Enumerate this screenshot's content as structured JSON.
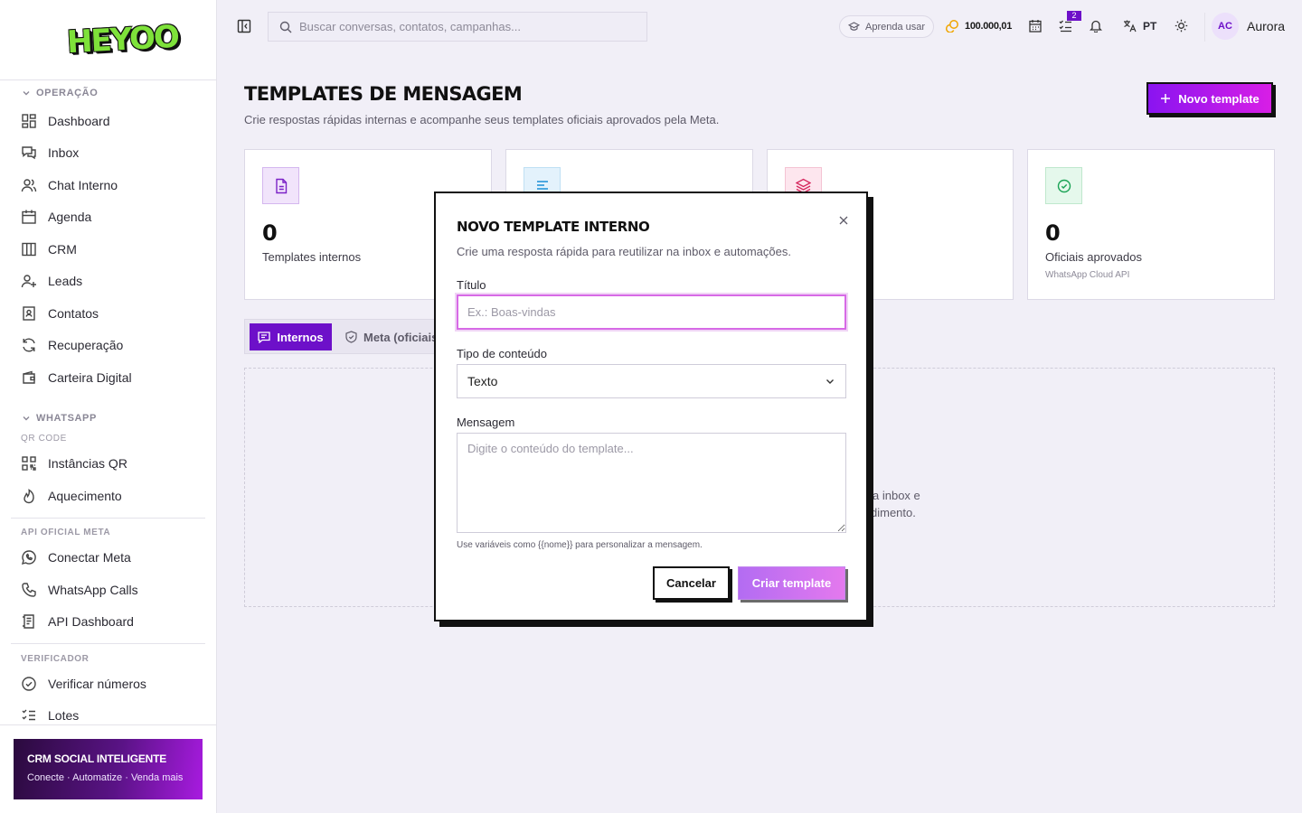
{
  "brand": {
    "logo": "HEYOO"
  },
  "sidebar": {
    "sections": [
      {
        "title": "OPERAÇÃO",
        "items": [
          "Dashboard",
          "Inbox",
          "Chat Interno",
          "Agenda",
          "CRM",
          "Leads",
          "Contatos",
          "Recuperação",
          "Carteira Digital"
        ]
      },
      {
        "title": "WHATSAPP",
        "subtitle": "QR CODE",
        "items": [
          "Instâncias QR",
          "Aquecimento"
        ]
      },
      {
        "title": "API OFICIAL META",
        "items": [
          "Conectar Meta",
          "WhatsApp Calls",
          "API Dashboard"
        ]
      },
      {
        "title": "VERIFICADOR",
        "items": [
          "Verificar números",
          "Lotes"
        ]
      }
    ],
    "promo": {
      "title": "CRM SOCIAL INTELIGENTE",
      "subtitle": "Conecte · Automatize · Venda mais"
    }
  },
  "topbar": {
    "search_placeholder": "Buscar conversas, contatos, campanhas...",
    "learn": "Aprenda usar",
    "coins": "100.000,01",
    "tasks_badge": "2",
    "lang": "PT",
    "user_initials": "AC",
    "user_name": "Aurora"
  },
  "page": {
    "title": "TEMPLATES DE MENSAGEM",
    "subtitle": "Crie respostas rápidas internas e acompanhe seus templates oficiais aprovados pela Meta.",
    "new_button": "Novo template"
  },
  "cards": [
    {
      "value": "0",
      "label": "Templates internos",
      "icon": "file-text-icon"
    },
    {
      "icon": "align-left-icon"
    },
    {
      "icon": "layers-icon"
    },
    {
      "value": "0",
      "label": "Oficiais aprovados",
      "small": "WhatsApp Cloud API",
      "icon": "check-circle-icon"
    }
  ],
  "tabs": {
    "active": "Internos",
    "other": "Meta (oficiais"
  },
  "empty": {
    "line1": "a inbox e",
    "line2": "dimento."
  },
  "modal": {
    "title": "NOVO TEMPLATE INTERNO",
    "subtitle": "Crie uma resposta rápida para reutilizar na inbox e automações.",
    "title_label": "Título",
    "title_placeholder": "Ex.: Boas-vindas",
    "type_label": "Tipo de conteúdo",
    "type_value": "Texto",
    "message_label": "Mensagem",
    "message_placeholder": "Digite o conteúdo do template...",
    "hint": "Use variáveis como {{nome}} para personalizar a mensagem.",
    "cancel": "Cancelar",
    "create": "Criar template"
  },
  "colors": {
    "accent": "#6d10c9",
    "brand_green": "#7ee23a",
    "pink": "#d81ee6"
  }
}
